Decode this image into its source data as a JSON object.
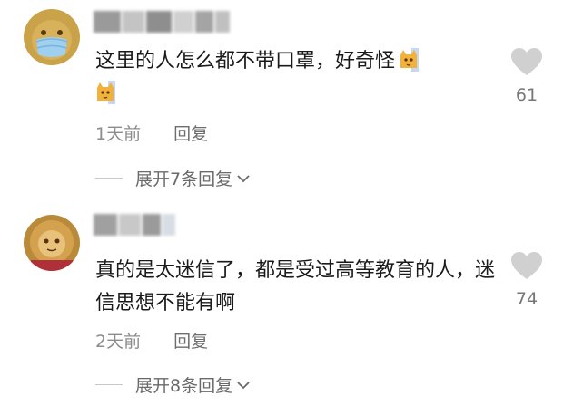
{
  "comments": [
    {
      "text": "这里的人怎么都不带口罩，好奇怪",
      "emoji_count": 2,
      "likes": "61",
      "time": "1天前",
      "reply_label": "回复",
      "expand_label": "展开7条回复"
    },
    {
      "text": "真的是太迷信了，都是受过高等教育的人，迷信思想不能有啊",
      "likes": "74",
      "time": "2天前",
      "reply_label": "回复",
      "expand_label": "展开8条回复"
    }
  ],
  "icons": {
    "like": "heart-icon",
    "expand": "chevron-down-icon",
    "emoji": "cat-emoji-icon"
  },
  "colors": {
    "text": "#1a1a1a",
    "meta": "#8c8c8c",
    "heart": "#d0d0d0"
  }
}
